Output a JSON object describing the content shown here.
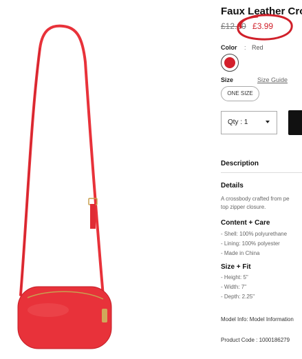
{
  "product": {
    "title": "Faux Leather Cro",
    "price_old": "£12.00",
    "price_new": "£3.99",
    "color_label": "Color",
    "color_sep": ":",
    "color_value": "Red",
    "swatch_color": "#d3202c",
    "size_label": "Size",
    "size_guide": "Size Guide",
    "size_option": "ONE SIZE",
    "qty_label": "Qty : 1"
  },
  "description": {
    "heading": "Description",
    "details_heading": "Details",
    "details_lines": [
      "A crossbody crafted from pe",
      "top zipper closure."
    ],
    "content_heading": "Content + Care",
    "content_items": [
      "- Shell: 100% polyurethane",
      "- Lining: 100% polyester",
      "- Made in China"
    ],
    "size_fit_heading": "Size + Fit",
    "size_fit_items": [
      "- Height: 5\"",
      "- Width: 7\"",
      "- Depth: 2.25\""
    ],
    "model_info": "Model Info: Model Information",
    "product_code": "Product Code : 1000186279"
  },
  "colors": {
    "accent_red": "#d0202a",
    "bag_red": "#e8323a",
    "highlight_ring": "#d0202a"
  }
}
